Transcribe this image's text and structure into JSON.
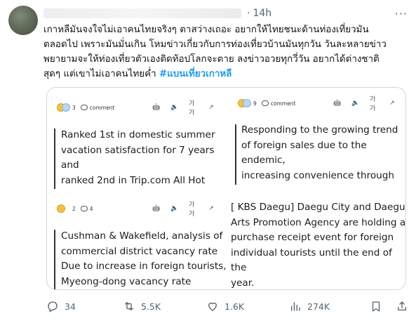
{
  "post": {
    "time": "14h",
    "separator": "·",
    "more_label": "···",
    "text": "เกาหลีมันจงใจไม่เอาคนไทยจริงๆ ตาสว่างเถอะ อยากให้ไทยชนะด้านท่องเที่ยวมัน\nตลอดไป เพราะมันมั่นเกิน โหมข่าวเกี่ยวกับการท่องเที่ยวบ้านมันทุกวัน วันละหลายข่าว\nพยายามจะให้ท่องเที่ยวตัวเองติดท้อปโลกจะตาย ลงข่าวอวยทุกวี่วัน อยากได้ต่างชาติ\nสุดๆ แต่เขาไม่เอาคนไทยค่ำ ",
    "hashtag": "#แบนเที่ยวเกาหลี"
  },
  "media": {
    "cards": [
      {
        "reaction_count": "3",
        "comment_label": "comment",
        "text": "Ranked 1st in domestic summer\nvacation satisfaction for 7 years\nand\nranked 2nd in Trip.com All Hot"
      },
      {
        "reaction_count": "9",
        "comment_label": "comment",
        "text": "Responding to the growing trend\nof foreign sales due to the\nendemic,\nincreasing convenience through"
      },
      {
        "reaction_count": "2",
        "comment_count": "4",
        "text": "Cushman & Wakefield, analysis of\ncommercial district vacancy rate\nDue to increase in foreign tourists,\nMyeong-dong vacancy rate"
      },
      {
        "text": "[ KBS Daegu] Daegu City and Daegu\nArts Promotion Agency are holding a\npurchase receipt event for foreign\nindividual tourists until the end of the\nyear."
      }
    ],
    "font_size_label": "가가"
  },
  "actions": {
    "replies": "34",
    "reposts": "5.5K",
    "likes": "1.6K",
    "views": "274K"
  }
}
